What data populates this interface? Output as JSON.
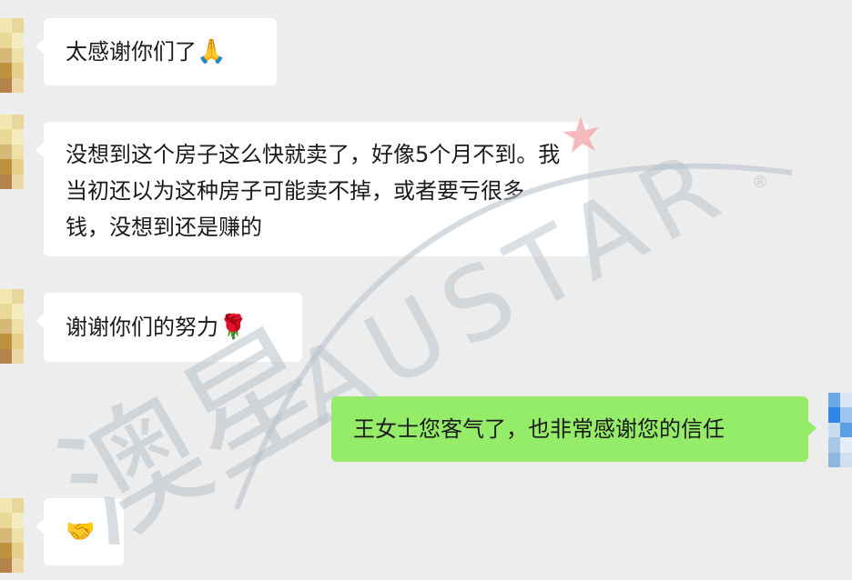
{
  "messages": [
    {
      "side": "in",
      "text": "太感谢你们了",
      "emoji": "🙏"
    },
    {
      "side": "in",
      "text": "没想到这个房子这么快就卖了，好像5个月不到。我当初还以为这种房子可能卖不掉，或者要亏很多钱，没想到还是赚的",
      "emoji": ""
    },
    {
      "side": "in",
      "text": "谢谢你们的努力",
      "emoji": "🌹"
    },
    {
      "side": "out",
      "text": "王女士您客气了，也非常感谢您的信任",
      "emoji": ""
    },
    {
      "side": "in",
      "text": "",
      "emoji": "🤝"
    }
  ],
  "watermark": {
    "chinese": "澳星",
    "latin": "AUSTAR",
    "registered": "®",
    "color": "#b9c3cc",
    "star_color": "#f3a3a3"
  },
  "colors": {
    "background": "#ededed",
    "incoming_bubble": "#ffffff",
    "outgoing_bubble": "#95ec69"
  }
}
